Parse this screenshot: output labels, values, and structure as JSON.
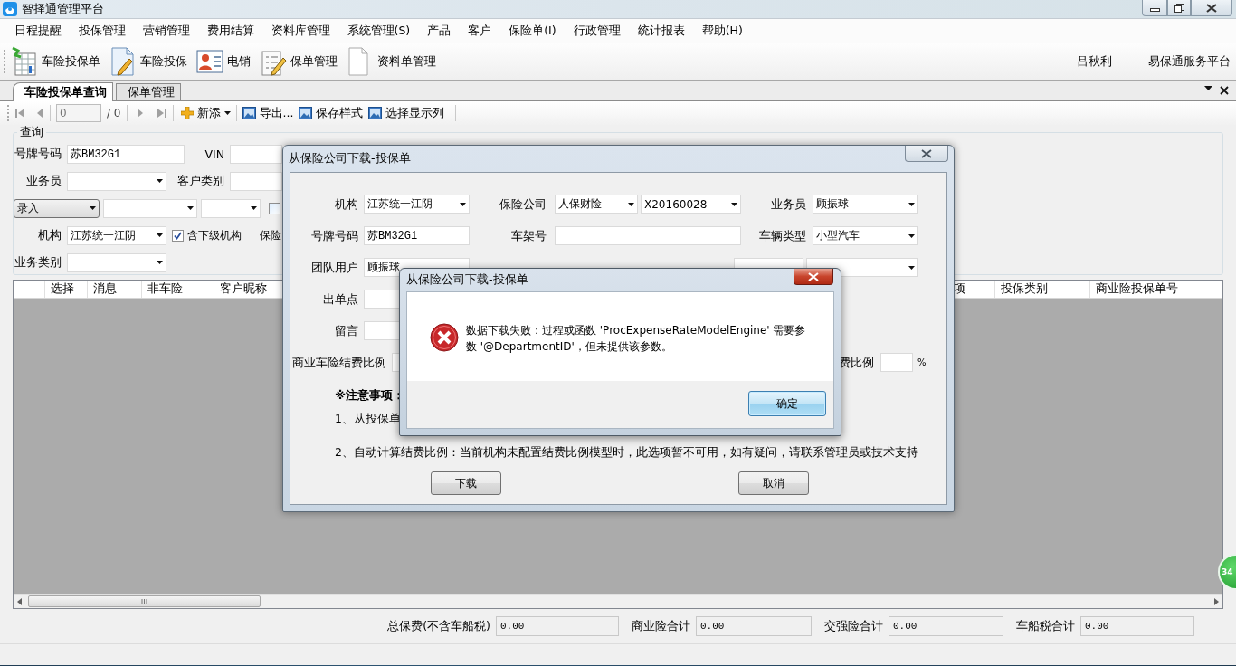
{
  "window": {
    "title": "智择通管理平台"
  },
  "menu": [
    "日程提醒",
    "投保管理",
    "营销管理",
    "费用结算",
    "资料库管理",
    "系统管理(S)",
    "产品",
    "客户",
    "保险单(I)",
    "行政管理",
    "统计报表",
    "帮助(H)"
  ],
  "toolbar": [
    {
      "label": "车险投保单",
      "kind": "sheet"
    },
    {
      "label": "车险投保",
      "kind": "doc-pen"
    },
    {
      "label": "电销",
      "kind": "contact"
    },
    {
      "label": "保单管理",
      "kind": "note-pen"
    },
    {
      "label": "资料单管理",
      "kind": "doc"
    }
  ],
  "user": "吕秋利",
  "platform": "易保通服务平台",
  "doc_tabs": [
    {
      "label": "车险投保单查询",
      "selected": true
    },
    {
      "label": "保单管理",
      "selected": false
    }
  ],
  "pager": {
    "page": "0",
    "total": "/ 0"
  },
  "actions": [
    {
      "label": "新添",
      "kind": "add"
    },
    {
      "label": "导出...",
      "kind": "image"
    },
    {
      "label": "保存样式",
      "kind": "image"
    },
    {
      "label": "选择显示列",
      "kind": "image"
    }
  ],
  "query": {
    "title": "查询",
    "rows": [
      [
        {
          "kind": "label",
          "text": "号牌号码"
        },
        {
          "kind": "text",
          "value": "苏BM32G1"
        },
        {
          "kind": "label",
          "text": "VIN"
        },
        {
          "kind": "text"
        }
      ],
      [
        {
          "kind": "label",
          "text": "业务员"
        },
        {
          "kind": "combo"
        },
        {
          "kind": "label",
          "text": "客户类别"
        },
        {
          "kind": "text"
        }
      ],
      [
        {
          "kind": "select",
          "value": "录入"
        },
        {
          "kind": "combo"
        },
        {
          "kind": "combo"
        },
        {
          "kind": "check",
          "checked": false
        }
      ],
      [
        {
          "kind": "label",
          "text": "机构"
        },
        {
          "kind": "combo",
          "value": "江苏统一江阴"
        },
        {
          "kind": "check",
          "checked": true,
          "text": "含下级机构"
        },
        {
          "kind": "label",
          "text": "保险"
        }
      ],
      [
        {
          "kind": "label",
          "text": "业务类别"
        },
        {
          "kind": "combo"
        }
      ]
    ]
  },
  "grid": {
    "columns_left": [
      "选择",
      "消息",
      "非车险",
      "客户昵称"
    ],
    "columns_right": [
      "项",
      "投保类别",
      "商业险投保单号"
    ]
  },
  "totals": [
    {
      "label": "总保费(不含车船税)",
      "value": "0.00"
    },
    {
      "label": "商业险合计",
      "value": "0.00"
    },
    {
      "label": "交强险合计",
      "value": "0.00"
    },
    {
      "label": "车船税合计",
      "value": "0.00"
    }
  ],
  "badge": "34",
  "download_dialog": {
    "title": "从保险公司下载-投保单",
    "rows": [
      {
        "fields": [
          {
            "kind": "label",
            "text": "机构"
          },
          {
            "kind": "combo",
            "value": "江苏统一江阴"
          },
          {
            "kind": "label",
            "text": "保险公司"
          },
          {
            "kind": "combo-pair",
            "value": "人保财险",
            "code": "X20160028"
          },
          {
            "kind": "label",
            "text": "业务员"
          },
          {
            "kind": "combo",
            "value": "顾振球"
          }
        ]
      },
      {
        "fields": [
          {
            "kind": "label",
            "text": "号牌号码"
          },
          {
            "kind": "text",
            "value": "苏BM32G1"
          },
          {
            "kind": "label",
            "text": "车架号"
          },
          {
            "kind": "text"
          },
          {
            "kind": "label",
            "text": "车辆类型"
          },
          {
            "kind": "combo",
            "value": "小型汽车"
          }
        ]
      },
      {
        "fields": [
          {
            "kind": "label",
            "text": "团队用户"
          },
          {
            "kind": "text",
            "value": "顾振球"
          },
          {
            "kind": "text"
          },
          {
            "kind": "combo"
          }
        ]
      },
      {
        "fields": [
          {
            "kind": "label",
            "text": "出单点"
          },
          {
            "kind": "text"
          }
        ]
      },
      {
        "fields": [
          {
            "kind": "label",
            "text": "留言"
          },
          {
            "kind": "text"
          }
        ]
      },
      {
        "fields": [
          {
            "kind": "label",
            "text": "商业车险结费比例"
          },
          {
            "kind": "text"
          },
          {
            "kind": "label",
            "text": "费比例"
          },
          {
            "kind": "text"
          },
          {
            "kind": "unit",
            "text": "%"
          }
        ]
      }
    ],
    "notes_title": "※注意事项：",
    "notes": [
      "1、从投保单",
      "2、自动计算结费比例：当前机构未配置结费比例模型时，此选项暂不可用，如有疑问，请联系管理员或技术支持"
    ],
    "buttons": [
      "下载",
      "取消"
    ]
  },
  "error_dialog": {
    "title": "从保险公司下载-投保单",
    "message": "数据下载失败：过程或函数 'ProcExpenseRateModelEngine' 需要参数 '@DepartmentID'，但未提供该参数。",
    "button": "确定"
  }
}
